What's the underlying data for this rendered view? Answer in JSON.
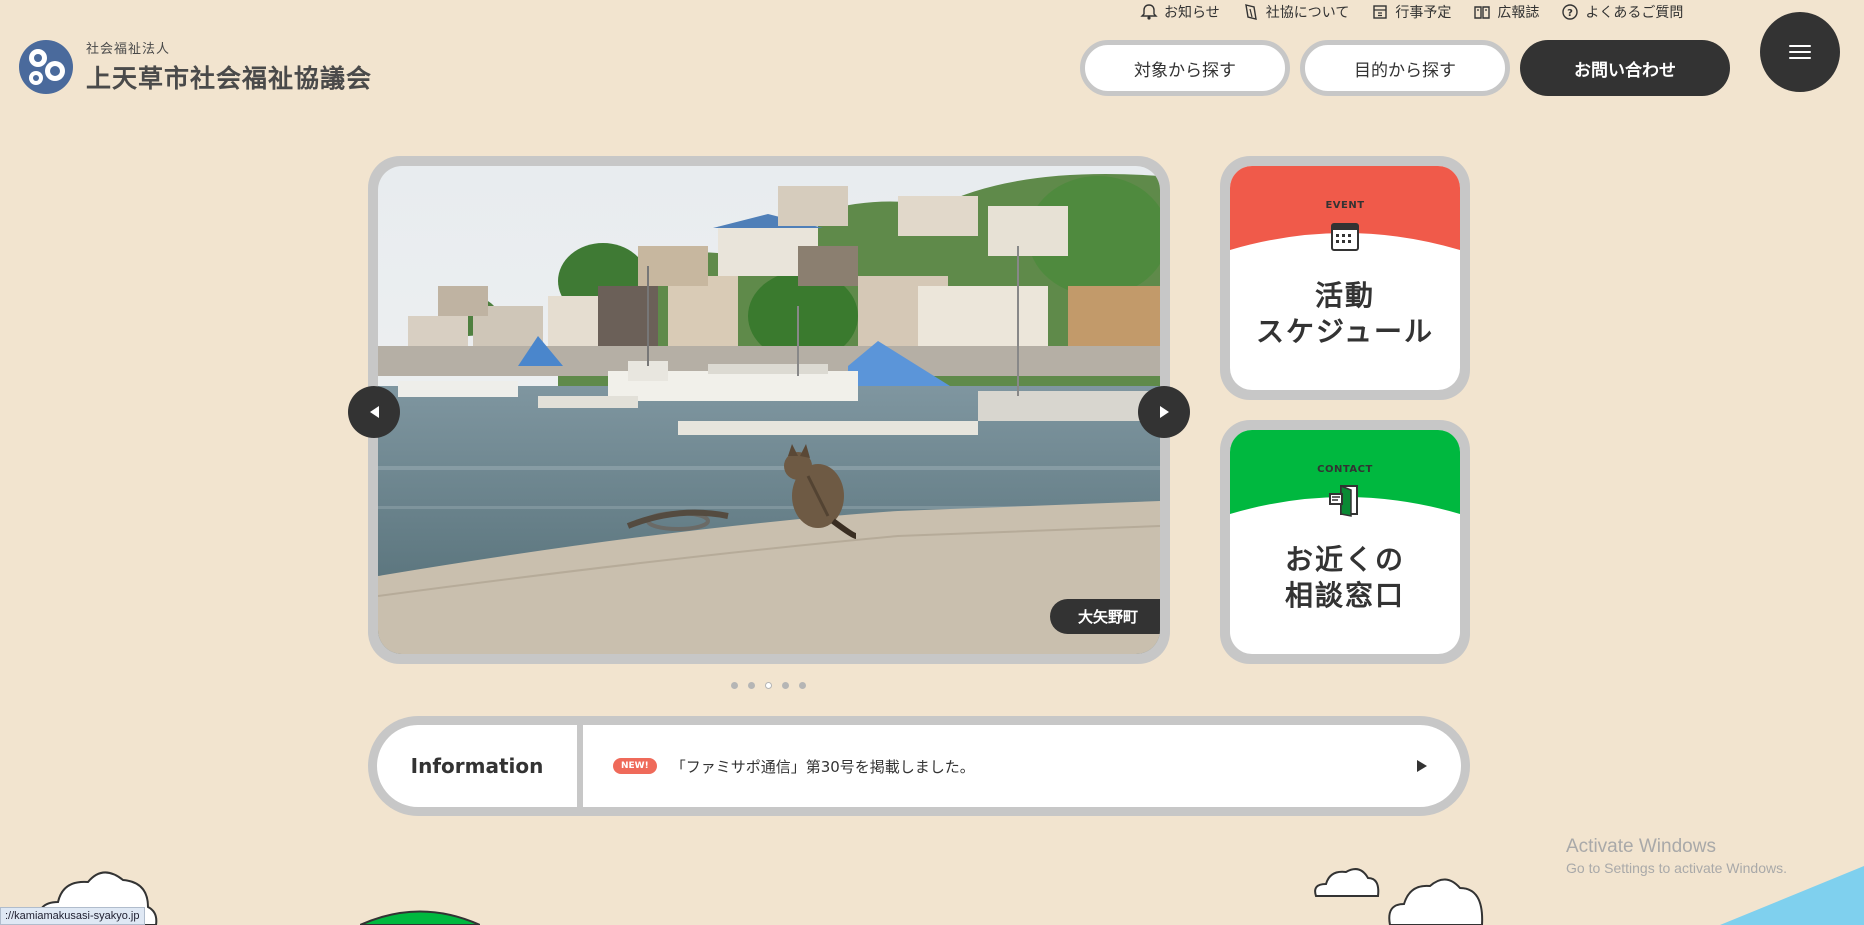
{
  "header": {
    "logo_sub": "社会福祉法人",
    "logo_main": "上天草市社会福祉協議会",
    "topnav": [
      {
        "label": "お知らせ",
        "icon": "bell-icon"
      },
      {
        "label": "社協について",
        "icon": "leaf-icon"
      },
      {
        "label": "行事予定",
        "icon": "calendar-icon"
      },
      {
        "label": "広報誌",
        "icon": "book-icon"
      },
      {
        "label": "よくあるご質問",
        "icon": "question-icon"
      }
    ],
    "buttons": {
      "target": "対象から探す",
      "purpose": "目的から探す",
      "contact": "お問い合わせ"
    }
  },
  "slider": {
    "caption": "大矢野町",
    "dot_count": 5,
    "active_dot": 3
  },
  "cards": {
    "event": {
      "label": "EVENT",
      "title_line1": "活動",
      "title_line2": "スケジュール",
      "color": "#f05a4a"
    },
    "contact": {
      "label": "CONTACT",
      "title_line1": "お近くの",
      "title_line2": "相談窓口",
      "color": "#00b83f"
    }
  },
  "info": {
    "label": "Information",
    "badge": "NEW!",
    "text": "「ファミサポ通信」第30号を掲載しました。"
  },
  "status_url": "://kamiamakusasi-syakyo.jp",
  "watermark": {
    "line1": "Activate Windows",
    "line2": "Go to Settings to activate Windows."
  },
  "colors": {
    "background": "#f2e4cf",
    "dark": "#333333",
    "frame": "#c7c7c7",
    "logo_blue": "#4a6a9c"
  }
}
